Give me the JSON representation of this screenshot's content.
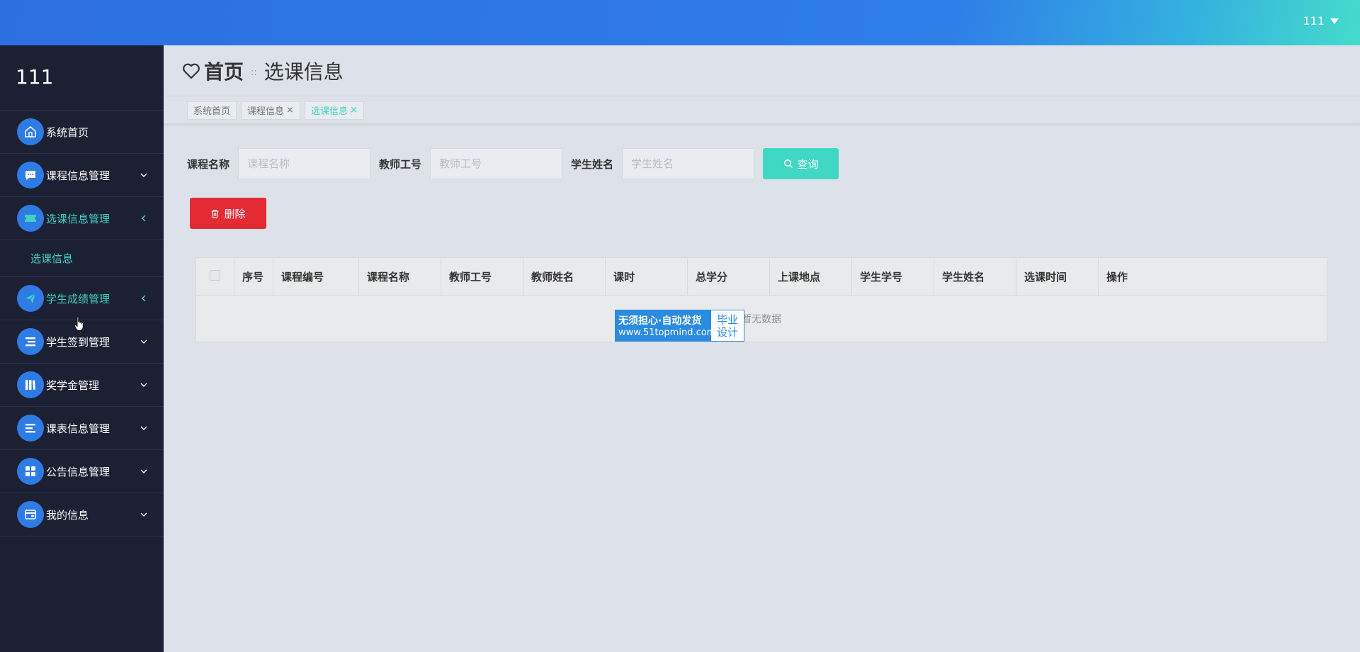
{
  "header": {
    "user_name": "111"
  },
  "sidebar": {
    "brand": "111",
    "items": [
      {
        "label": "系统首页",
        "icon": "home-icon",
        "arrow": "none"
      },
      {
        "label": "课程信息管理",
        "icon": "chat-icon",
        "arrow": "down"
      },
      {
        "label": "选课信息管理",
        "icon": "ticket-icon",
        "arrow": "left",
        "active": true
      },
      {
        "label": "学生成绩管理",
        "icon": "send-icon",
        "arrow": "left",
        "active": true
      },
      {
        "label": "学生签到管理",
        "icon": "list-icon",
        "arrow": "down"
      },
      {
        "label": "奖学金管理",
        "icon": "book-icon",
        "arrow": "down"
      },
      {
        "label": "课表信息管理",
        "icon": "lines-icon",
        "arrow": "down"
      },
      {
        "label": "公告信息管理",
        "icon": "grid-icon",
        "arrow": "down"
      },
      {
        "label": "我的信息",
        "icon": "card-icon",
        "arrow": "down"
      }
    ],
    "submenu": {
      "label": "选课信息"
    }
  },
  "breadcrumb": {
    "home": "首页",
    "separator": "::",
    "current": "选课信息"
  },
  "tags": [
    {
      "label": "系统首页"
    },
    {
      "label": "课程信息"
    },
    {
      "label": "选课信息"
    }
  ],
  "search": {
    "fields": [
      {
        "label": "课程名称",
        "placeholder": "课程名称",
        "value": ""
      },
      {
        "label": "教师工号",
        "placeholder": "教师工号",
        "value": ""
      },
      {
        "label": "学生姓名",
        "placeholder": "学生姓名",
        "value": ""
      }
    ],
    "button_label": "查询"
  },
  "delete_button_label": "删除",
  "table": {
    "columns": [
      "序号",
      "课程编号",
      "课程名称",
      "教师工号",
      "教师姓名",
      "课时",
      "总学分",
      "上课地点",
      "学生学号",
      "学生姓名",
      "选课时间",
      "操作"
    ],
    "empty_text": "暂无数据"
  },
  "watermark": {
    "line1": "无须担心·自动发货",
    "line2": "www.51topmind.com",
    "right_top": "毕业",
    "right_bottom": "设计"
  },
  "colors": {
    "accent": "#3fd2c6",
    "primary": "#2e7be4",
    "danger": "#e42a33",
    "sidebar_bg": "#1c2033"
  }
}
